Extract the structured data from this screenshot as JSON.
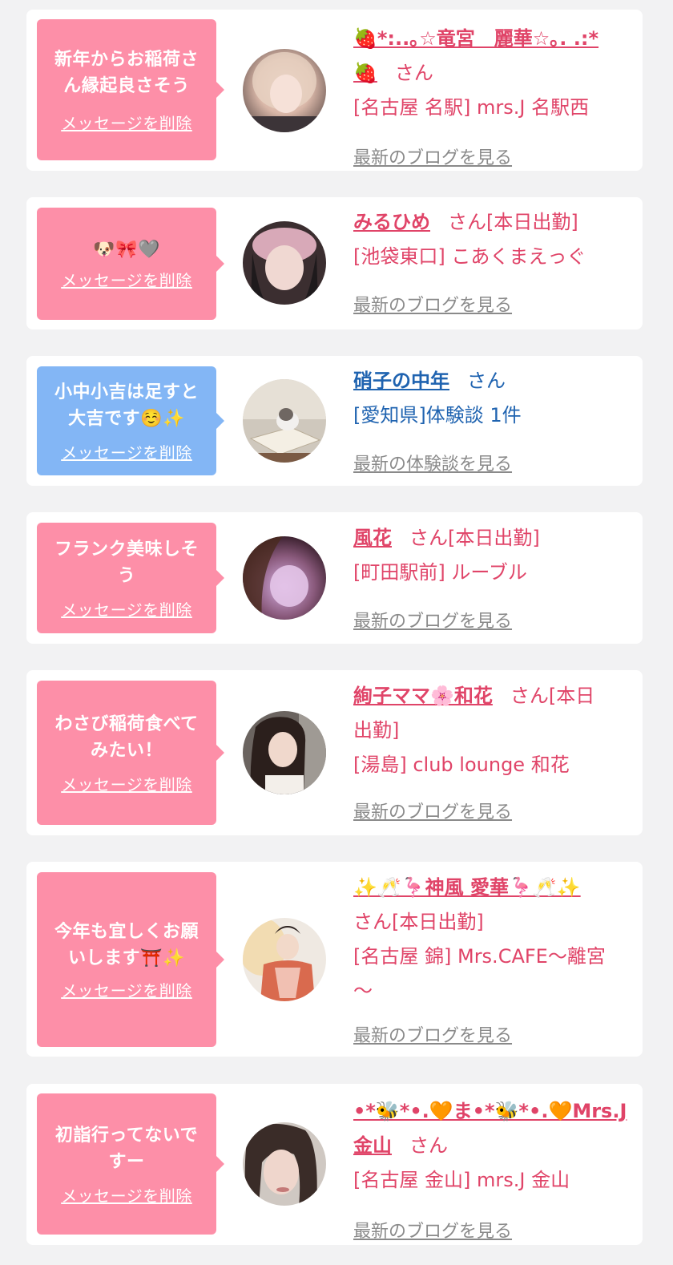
{
  "colors": {
    "pink_bubble": "#fd8fa8",
    "blue_bubble": "#83b6f5",
    "name_pink": "#e04468",
    "name_blue": "#1f63b0",
    "link_gray": "#8a8a8a"
  },
  "delete_label": "メッセージを削除",
  "cards": [
    {
      "message_lines": [
        "新年からお稲荷さ",
        "ん縁起良さそう"
      ],
      "name_lines": [
        "🍓*:..｡☆竜宮　麗華☆｡. .:*",
        "🍓"
      ],
      "san": "さん",
      "status": "",
      "shop": "[名古屋 名駅] mrs.J 名駅西",
      "blog_link": "最新のブログを見る"
    },
    {
      "message_lines": [
        "🐶🎀🩶"
      ],
      "name_lines": [
        "みるひめ"
      ],
      "san": "さん",
      "status": "[本日出勤]",
      "shop": "[池袋東口] こあくまえっぐ",
      "blog_link": "最新のブログを見る"
    },
    {
      "message_lines": [
        "小中小吉は足すと",
        "大吉です☺️✨"
      ],
      "name_lines": [
        "硝子の中年"
      ],
      "san": "さん",
      "status": "",
      "shop": "[愛知県]体験談 1件",
      "blog_link": "最新の体験談を見る"
    },
    {
      "message_lines": [
        "フランク美味しそ",
        "う"
      ],
      "name_lines": [
        "風花"
      ],
      "san": "さん",
      "status": "[本日出勤]",
      "shop": "[町田駅前] ルーブル",
      "blog_link": "最新のブログを見る"
    },
    {
      "message_lines": [
        "わさび稲荷食べて",
        "みたい！"
      ],
      "name_lines": [
        "絢子ママ🌸和花"
      ],
      "san": "さん",
      "status": "[本日",
      "status2": "出勤]",
      "shop": "[湯島] club lounge 和花",
      "blog_link": "最新のブログを見る"
    },
    {
      "message_lines": [
        "今年も宜しくお願",
        "いします⛩️✨"
      ],
      "name_lines": [
        "✨🥂🦩神風 愛華🦩🥂✨"
      ],
      "san": "さん",
      "status": "[本日出勤]",
      "shop": "[名古屋 錦] Mrs.CAFE〜離宮",
      "shop2": "〜",
      "blog_link": "最新のブログを見る"
    },
    {
      "message_lines": [
        "初詣行ってないで",
        "すー"
      ],
      "name_lines": [
        "•*🐝*•.🧡ま•*🐝*•.🧡Mrs.J",
        "金山"
      ],
      "san": "さん",
      "status": "",
      "shop": "[名古屋 金山] mrs.J 金山",
      "blog_link": "最新のブログを見る"
    }
  ]
}
